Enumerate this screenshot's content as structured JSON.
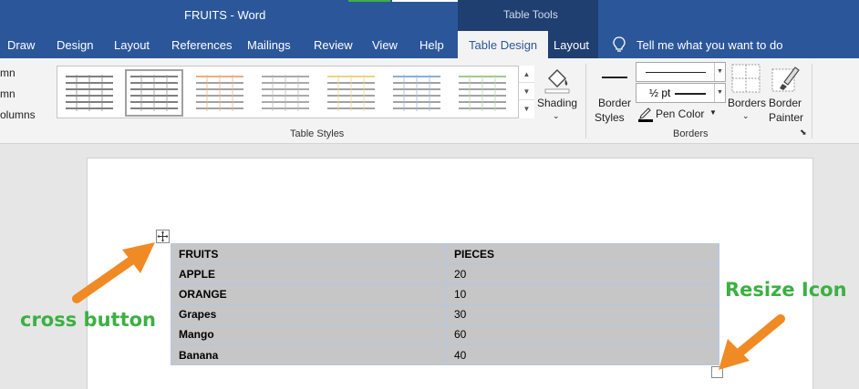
{
  "titlebar": {
    "title": "FRUITS  -  Word",
    "context_tab_group": "Table Tools"
  },
  "tabs": [
    "Draw",
    "Design",
    "Layout",
    "References",
    "Mailings",
    "Review",
    "View",
    "Help",
    "Table Design",
    "Layout"
  ],
  "active_tab": "Table Design",
  "tell_me": "Tell me what you want to do",
  "ribbon": {
    "left_partial": [
      "mn",
      "mn",
      "olumns"
    ],
    "table_styles_group": "Table Styles",
    "shading": "Shading",
    "border_styles_line1": "Border",
    "border_styles_line2": "Styles",
    "pen_weight": "½ pt",
    "pen_color": "Pen Color",
    "borders": "Borders",
    "border_painter_line1": "Border",
    "border_painter_line2": "Painter",
    "borders_group": "Borders"
  },
  "table": {
    "rows": [
      [
        "FRUITS",
        "PIECES"
      ],
      [
        "APPLE",
        "20"
      ],
      [
        "ORANGE",
        "10"
      ],
      [
        "Grapes",
        "30"
      ],
      [
        "Mango",
        "60"
      ],
      [
        "Banana",
        "40"
      ]
    ]
  },
  "annotations": {
    "cross": "cross button",
    "resize": "Resize Icon"
  },
  "colors": {
    "ribbon_blue": "#2b579a",
    "context_blue": "#1f3f70",
    "annotation_green": "#3cb043",
    "arrow_orange": "#f08a24",
    "cell_gray": "#c6c6c6"
  }
}
